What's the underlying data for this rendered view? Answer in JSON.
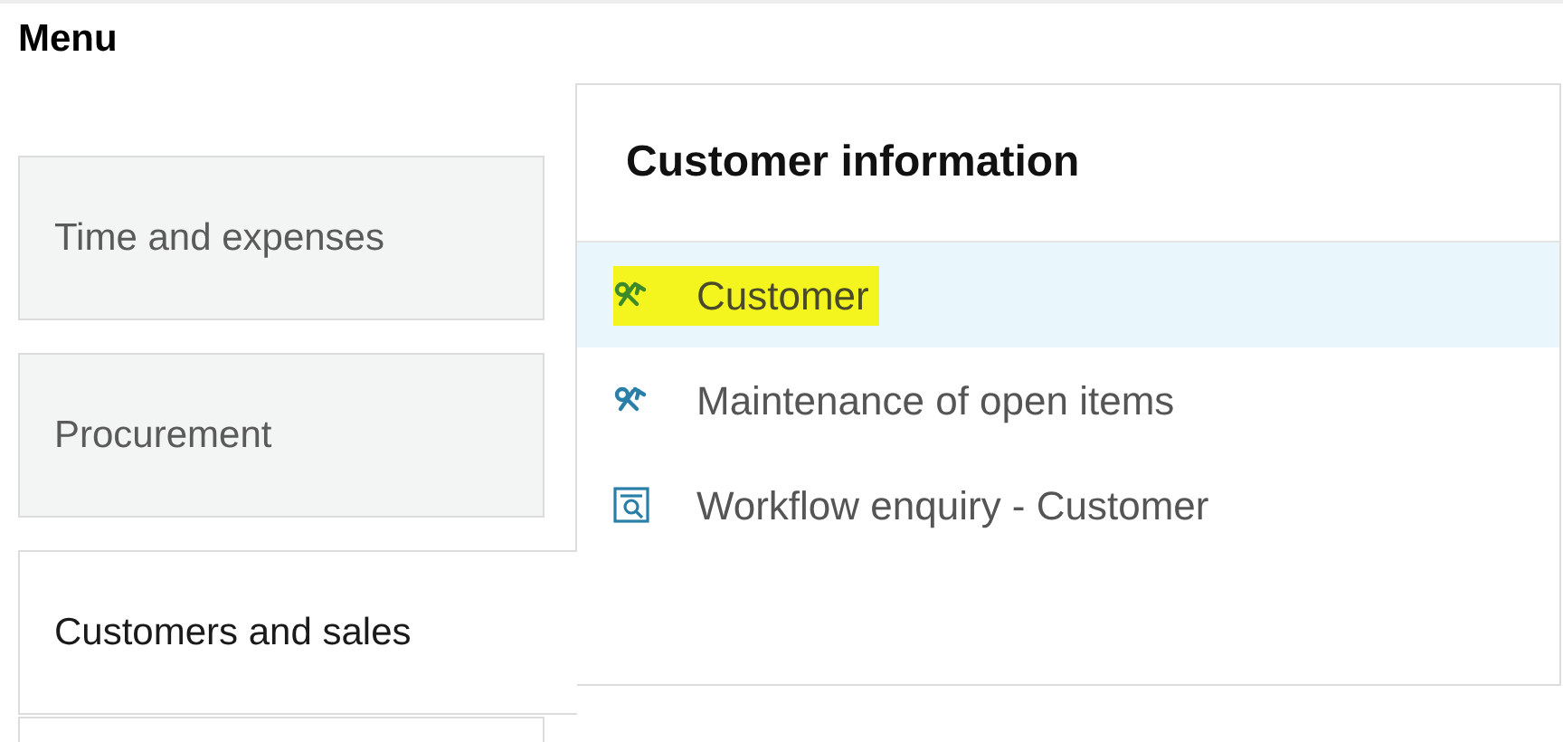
{
  "title": "Menu",
  "tiles": [
    {
      "label": "Time and expenses",
      "selected": false
    },
    {
      "label": "Procurement",
      "selected": false
    },
    {
      "label": "Customers and sales",
      "selected": true
    }
  ],
  "panel": {
    "title": "Customer information",
    "items": [
      {
        "kind": "transaction",
        "label": "Customer",
        "selected": true,
        "highlighted": true
      },
      {
        "kind": "transaction",
        "label": "Maintenance of open items",
        "selected": false,
        "highlighted": false
      },
      {
        "kind": "enquiry",
        "label": "Workflow enquiry - Customer",
        "selected": false,
        "highlighted": false
      }
    ]
  }
}
